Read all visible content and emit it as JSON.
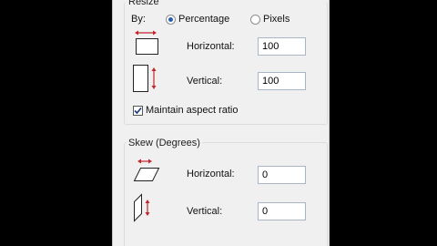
{
  "resize": {
    "title": "Resize",
    "by_label": "By:",
    "option_percentage": "Percentage",
    "option_pixels": "Pixels",
    "selected": "Percentage",
    "horizontal_label": "Horizontal:",
    "horizontal_value": "100",
    "vertical_label": "Vertical:",
    "vertical_value": "100",
    "aspect_label": "Maintain aspect ratio",
    "aspect_checked": true
  },
  "skew": {
    "title": "Skew (Degrees)",
    "horizontal_label": "Horizontal:",
    "horizontal_value": "0",
    "vertical_label": "Vertical:",
    "vertical_value": "0"
  },
  "colors": {
    "arrow": "#c0262c",
    "radio_dot": "#2a5db0"
  },
  "icons": [
    "resize-horizontal-icon",
    "resize-vertical-icon",
    "skew-horizontal-icon",
    "skew-vertical-icon",
    "checkmark-icon"
  ]
}
